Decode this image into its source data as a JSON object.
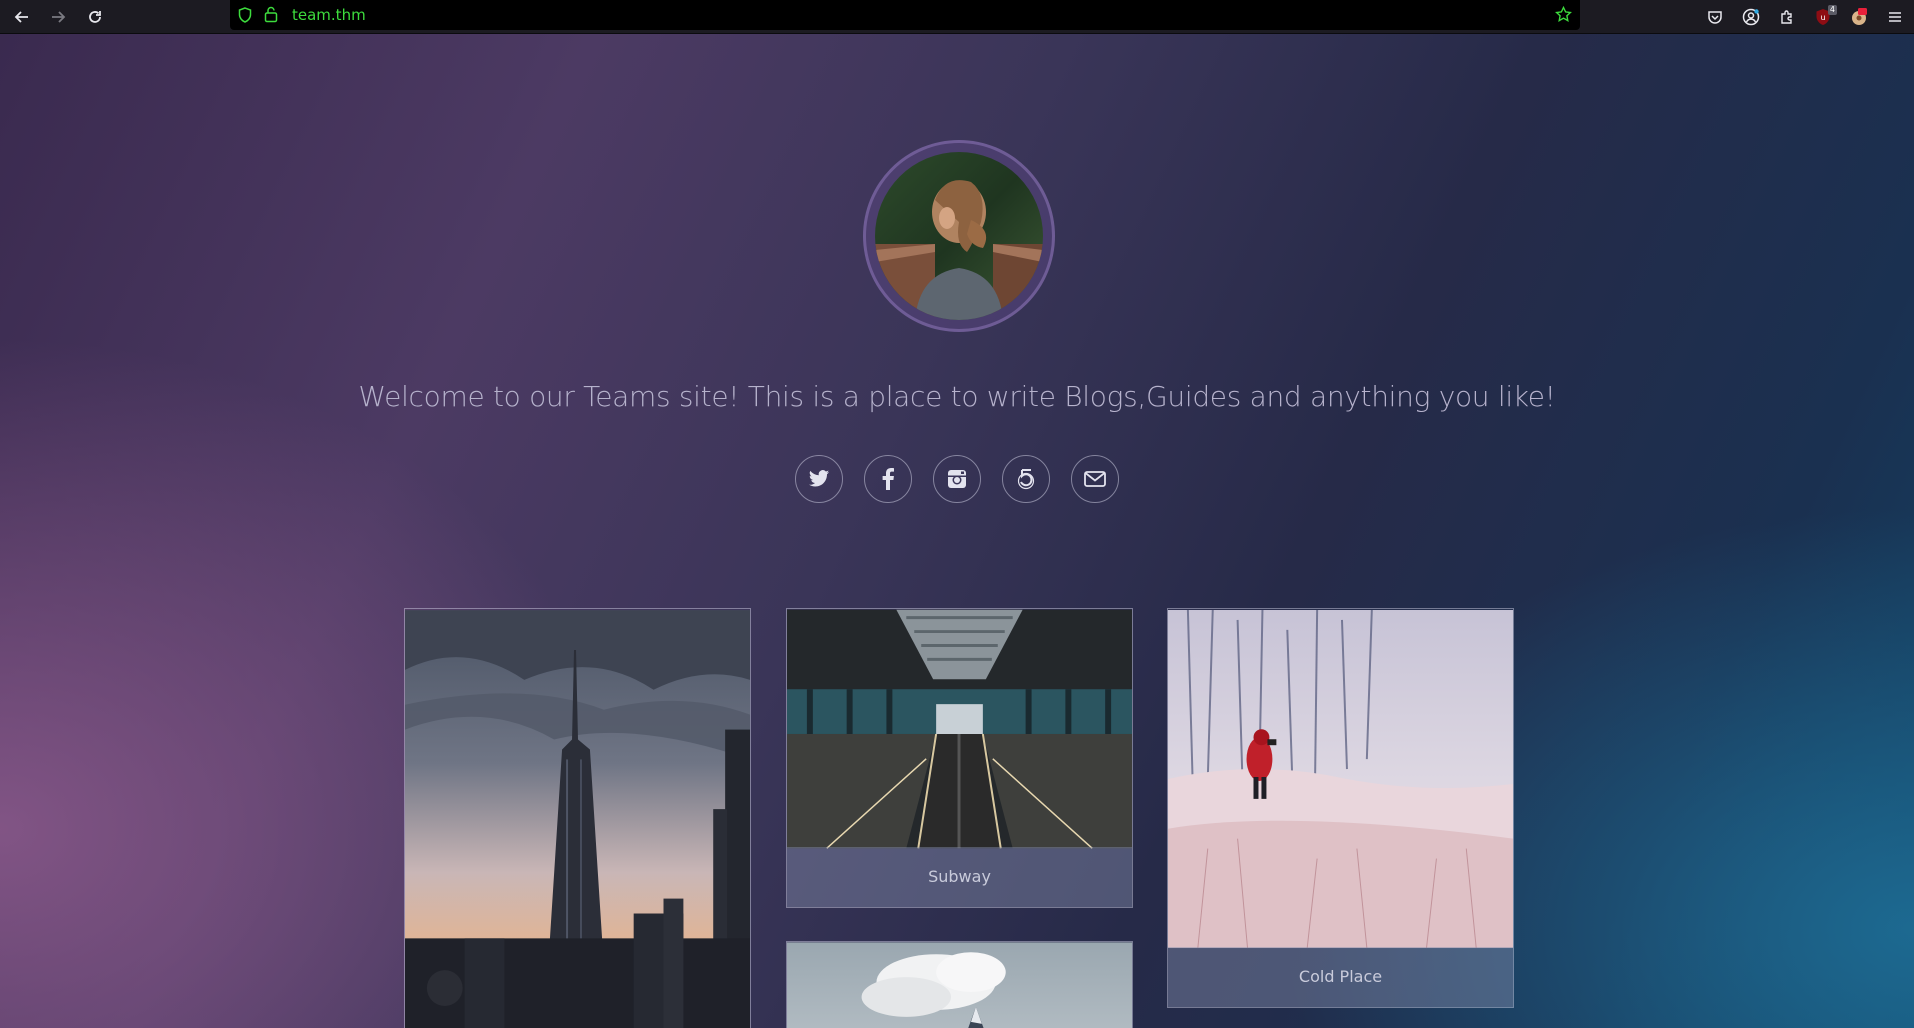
{
  "browser": {
    "url": "team.thm",
    "extension_badge": "4"
  },
  "page": {
    "welcome_text": "Welcome to our Teams site! This is a place to write Blogs,Guides and anything you like!",
    "social_icons": [
      "twitter-icon",
      "facebook-icon",
      "instagram-icon",
      "500px-icon",
      "mail-icon"
    ],
    "cards": [
      {
        "caption": ""
      },
      {
        "caption": "Subway"
      },
      {
        "caption": "Cold Place"
      },
      {
        "caption": ""
      }
    ]
  },
  "colors": {
    "url_text": "#3ddc3d",
    "welcome_text": "#b6b2cc"
  }
}
